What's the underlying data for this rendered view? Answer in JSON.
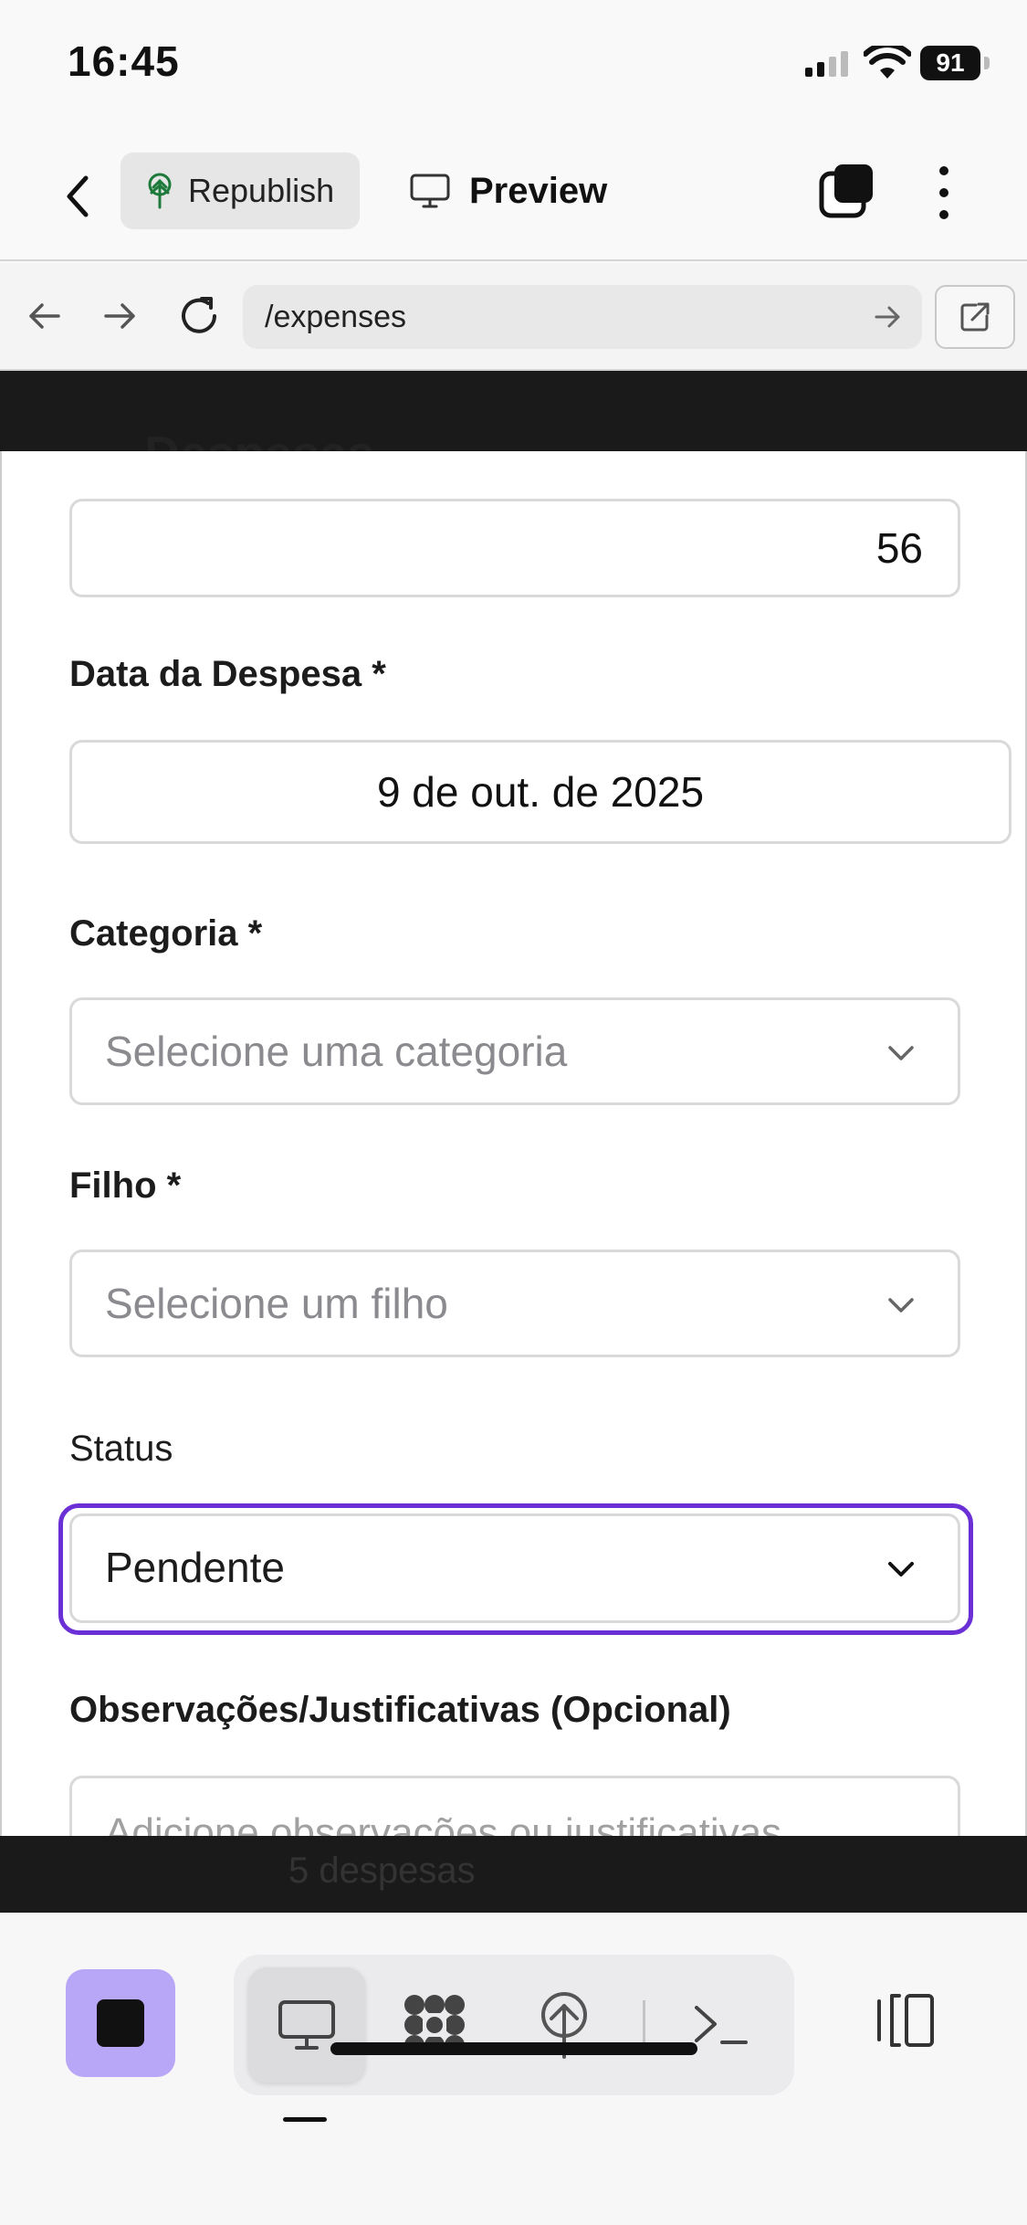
{
  "status_bar": {
    "time": "16:45",
    "battery": "91"
  },
  "toolbar": {
    "republish_label": "Republish",
    "preview_label": "Preview"
  },
  "url_bar": {
    "url": "/expenses"
  },
  "background_page": {
    "title": "Despesas",
    "count_text": "5 despesas"
  },
  "form": {
    "amount_value": "56",
    "date_label": "Data da Despesa *",
    "date_value": "9 de out. de 2025",
    "category_label": "Categoria *",
    "category_placeholder": "Selecione uma categoria",
    "child_label": "Filho *",
    "child_placeholder": "Selecione um filho",
    "status_label": "Status",
    "status_value": "Pendente",
    "notes_label": "Observações/Justificativas (Opcional)",
    "notes_placeholder": "Adicione observações ou justificativas"
  },
  "colors": {
    "focus_ring": "#6b2fd6",
    "stop_button": "#b8a6f7",
    "republish_icon": "#1e7a3a"
  },
  "dock": {
    "icons": [
      "stop-icon",
      "desktop-icon",
      "integrations-icon",
      "deploy-icon",
      "terminal-icon",
      "panels-icon"
    ]
  }
}
